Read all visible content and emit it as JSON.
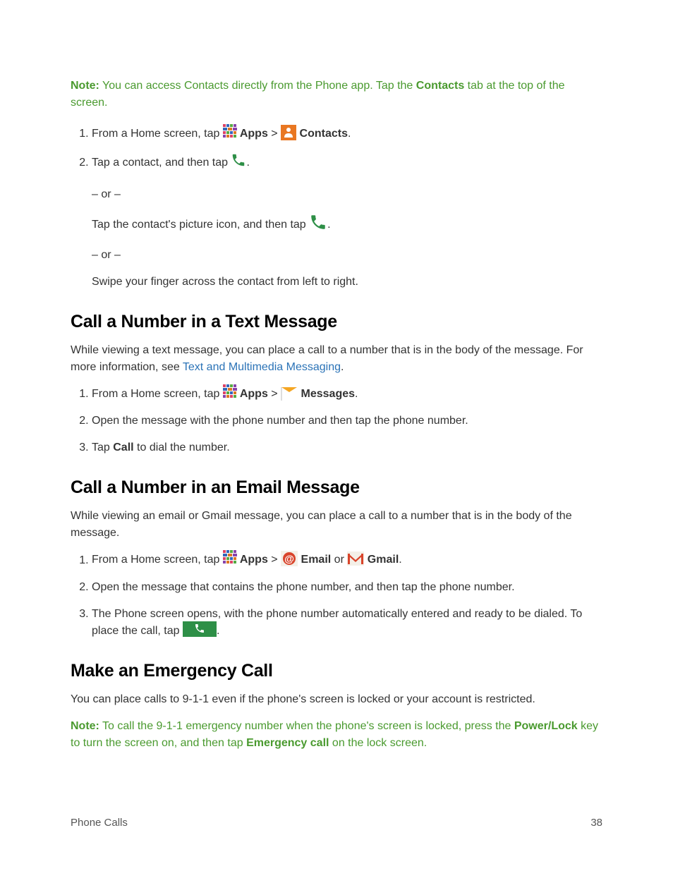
{
  "note1": {
    "label": "Note:",
    "text_part1": " You can access Contacts directly from the Phone app. Tap the ",
    "bold1": "Contacts",
    "text_part2": " tab at the top of the screen."
  },
  "steps1": {
    "s1_pre": "From a Home screen, tap ",
    "apps": "Apps",
    "gt": " > ",
    "contacts": "Contacts",
    "period": ".",
    "s2_pre": "Tap a contact, and then tap ",
    "or": "– or –",
    "s2b_pre": "Tap the contact's picture icon, and then tap ",
    "s2c": "Swipe your finger across the contact from left to right."
  },
  "heading1": "Call a Number in a Text Message",
  "para1": {
    "text1": "While viewing a text message, you can place a call to a number that is in the body of the message. For more information, see ",
    "link": "Text and Multimedia Messaging",
    "text2": "."
  },
  "steps2": {
    "s1_pre": "From a Home screen, tap ",
    "apps": "Apps",
    "gt": " > ",
    "messages": "Messages",
    "period": ".",
    "s2": "Open the message with the phone number and then tap the phone number.",
    "s3_pre": "Tap ",
    "s3_bold": "Call",
    "s3_post": " to dial the number."
  },
  "heading2": "Call a Number in an Email Message",
  "para2": "While viewing an email or Gmail message, you can place a call to a number that is in the body of the message.",
  "steps3": {
    "s1_pre": "From a Home screen, tap ",
    "apps": "Apps",
    "gt": " > ",
    "email": "Email",
    "or_word": " or ",
    "gmail": "Gmail",
    "period": ".",
    "s2": "Open the message that contains the phone number, and then tap the phone number.",
    "s3a": "The Phone screen opens, with the phone number automatically entered and ready to be dialed. To place the call, tap ",
    "s3b": "."
  },
  "heading3": "Make an Emergency Call",
  "para3": "You can place calls to 9-1-1 even if the phone's screen is locked or your account is restricted.",
  "note2": {
    "label": "Note:",
    "t1": " To call the 9-1-1 emergency number when the phone's screen is locked, press the ",
    "b1": "Power/Lock",
    "t2": " key to turn the screen on, and then tap ",
    "b2": "Emergency call",
    "t3": " on the lock screen."
  },
  "footer": {
    "section": "Phone Calls",
    "page": "38"
  }
}
